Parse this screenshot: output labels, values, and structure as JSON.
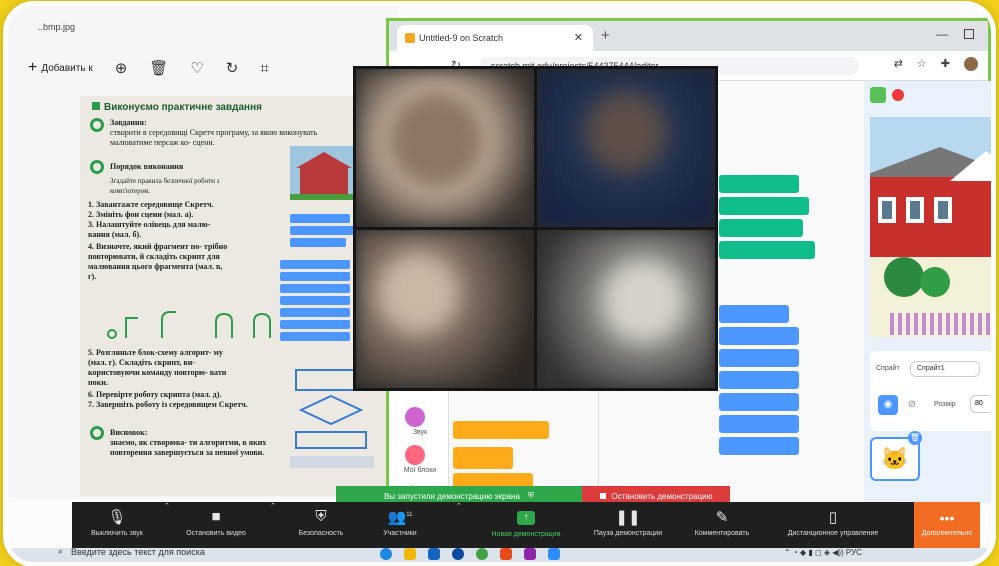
{
  "viewer": {
    "title": "..bmp.jpg",
    "add_label": "Добавить к",
    "doc": {
      "heading": "Виконуємо практичне завдання",
      "task_label": "Завдання:",
      "task_text": "створити в середовищі Скретч програму, за якою виконувать малюватиме персаж ко- сцени.",
      "order_heading": "Порядок виконання",
      "safety": "Згадайте правила безпечної роботи з комп'ютером.",
      "steps": [
        "1. Завантажте середовище Скретч.",
        "2. Змініть фон сцени (мал. а).",
        "3. Налаштуйте олівець для малю- вання (мал. б).",
        "4. Визначте, який фрагмент по- трібно повторювати, й складіть скрипт для малювання цього фрагмента (мал. в, г).",
        "5. Розгляньте блок-схему алгорит- му (мал. г). Складіть скрипт, ви- користовуючи команду повторю- вати поки.",
        "6. Перевірте роботу скрипта (мал. д).",
        "7. Завершіть роботу із середовищем Скретч."
      ],
      "conclusion_label": "Висновок:",
      "conclusion_text": "знаємо, як створюва- ти алгоритми, в яких повторення завершується за певної умови."
    }
  },
  "browser": {
    "tab_title": "Untitled-9 on Scratch",
    "url": "scratch.mit.edu/projects/544375444/editor"
  },
  "scratch": {
    "categories": [
      {
        "label": "Звук",
        "color": "#cf63cf"
      },
      {
        "label": "Мої блоки",
        "color": "#ff6680"
      }
    ],
    "sprite_label": "Спрайт",
    "sprite_name": "Спрайт1",
    "size_label": "Розмір",
    "size_value": "80"
  },
  "share": {
    "message": "Вы запустили демонстрацию экрана",
    "stop_label": "Остановить демонстрацию"
  },
  "zoom_toolbar": [
    {
      "id": "mute",
      "label": "Выключить звук",
      "icon": "mic-icon"
    },
    {
      "id": "video",
      "label": "Остановить видео",
      "icon": "camera-icon"
    },
    {
      "id": "security",
      "label": "Безопасность",
      "icon": "shield-icon"
    },
    {
      "id": "participants",
      "label": "Участники",
      "icon": "people-icon",
      "count": "11"
    },
    {
      "id": "new_share",
      "label": "Новая демонстрация",
      "icon": "share-up-icon"
    },
    {
      "id": "pause",
      "label": "Пауза демонстрации",
      "icon": "pause-icon"
    },
    {
      "id": "annotate",
      "label": "Комментировать",
      "icon": "pen-icon"
    },
    {
      "id": "remote",
      "label": "Дистанционное управление",
      "icon": "mouse-icon"
    },
    {
      "id": "more",
      "label": "Дополнительно",
      "icon": "more-icon"
    }
  ],
  "taskbar": {
    "search_placeholder": "Введите здесь текст для поиска",
    "tray_lang": "РУС"
  },
  "colors": {
    "frame_yellow": "#f4d21b",
    "browser_border": "#79c843",
    "share_green": "#2ea84a",
    "stop_red": "#dc3c3c",
    "more_orange": "#f26d21",
    "scratch_blue": "#4c97ff"
  }
}
